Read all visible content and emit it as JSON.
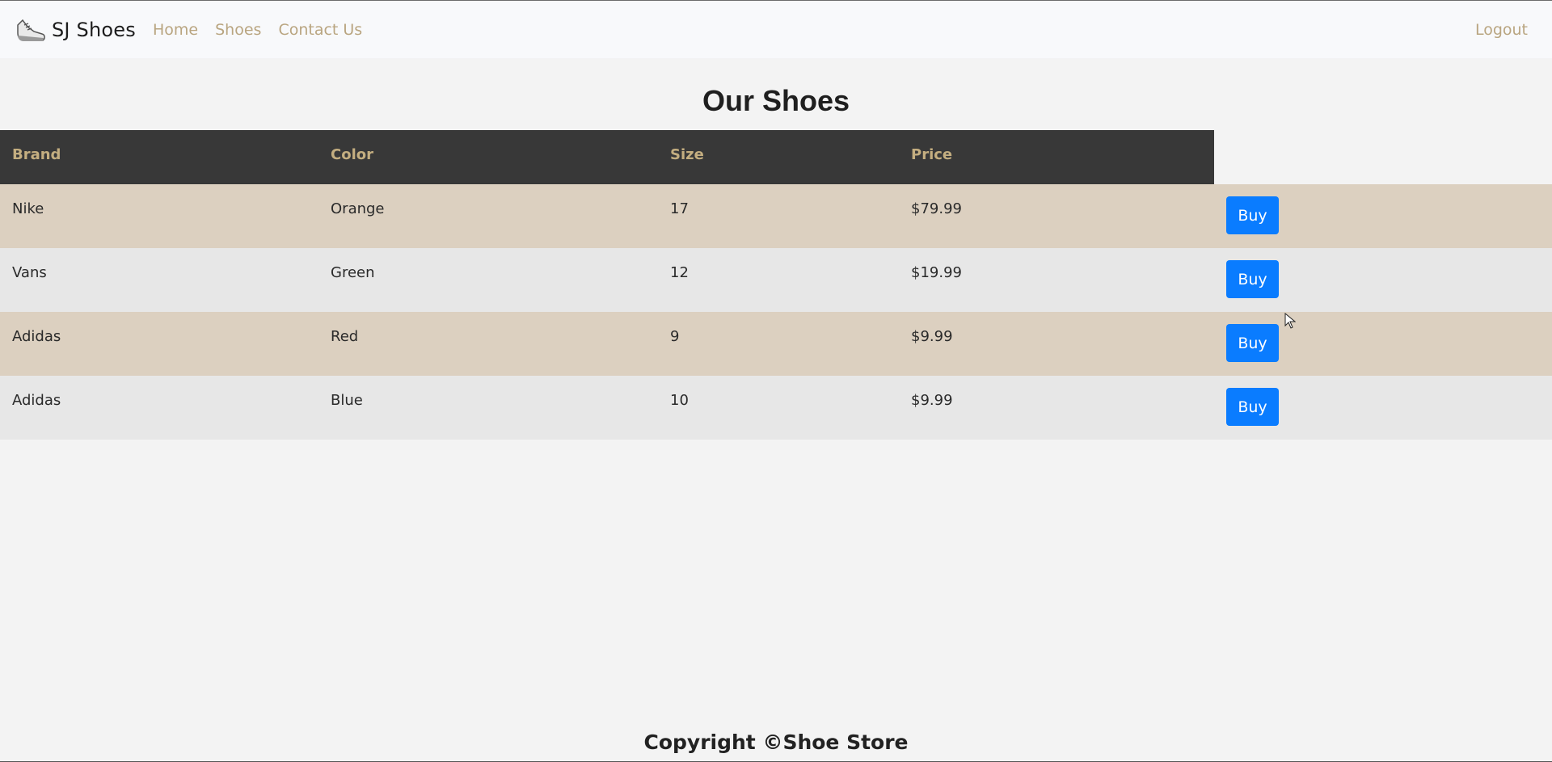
{
  "navbar": {
    "brand_name": "SJ Shoes",
    "brand_icon": "shoe-icon",
    "links": [
      "Home",
      "Shoes",
      "Contact Us"
    ],
    "logout_label": "Logout"
  },
  "page": {
    "title": "Our Shoes"
  },
  "table": {
    "headers": [
      "Brand",
      "Color",
      "Size",
      "Price"
    ],
    "rows": [
      {
        "brand": "Nike",
        "color": "Orange",
        "size": "17",
        "price": "$79.99",
        "action": "Buy"
      },
      {
        "brand": "Vans",
        "color": "Green",
        "size": "12",
        "price": "$19.99",
        "action": "Buy"
      },
      {
        "brand": "Adidas",
        "color": "Red",
        "size": "9",
        "price": "$9.99",
        "action": "Buy"
      },
      {
        "brand": "Adidas",
        "color": "Blue",
        "size": "10",
        "price": "$9.99",
        "action": "Buy"
      }
    ]
  },
  "footer": {
    "text": "Copyright ©Shoe Store"
  },
  "colors": {
    "accent": "#0a7cff",
    "nav_link": "#b9a580",
    "header_bg": "#383838",
    "row_odd": "#dcd0c0",
    "row_even": "#e7e7e7"
  }
}
